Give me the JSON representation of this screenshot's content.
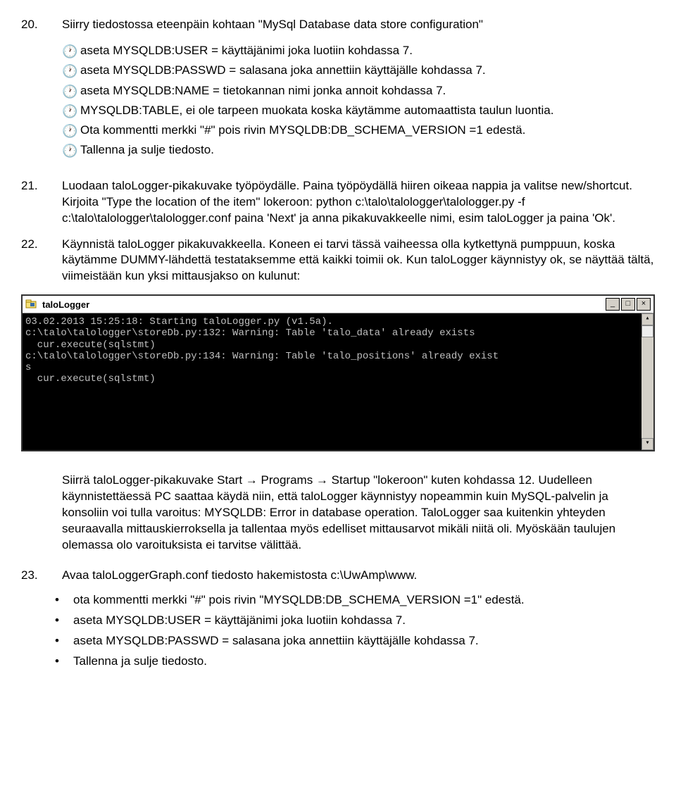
{
  "item20": {
    "num": "20.",
    "lead": "Siirry tiedostossa eteenpäin kohtaan \"MySql Database data store configuration\"",
    "bullets": [
      "aseta MYSQLDB:USER = käyttäjänimi joka luotiin kohdassa 7.",
      "aseta  MYSQLDB:PASSWD = salasana joka annettiin käyttäjälle kohdassa 7.",
      "aseta  MYSQLDB:NAME = tietokannan nimi jonka annoit kohdassa 7.",
      "MYSQLDB:TABLE, ei ole tarpeen muokata koska käytämme automaattista taulun luontia.",
      "Ota kommentti merkki \"#\" pois rivin  MYSQLDB:DB_SCHEMA_VERSION =1 edestä.",
      "Tallenna ja sulje tiedosto."
    ]
  },
  "item21": {
    "num": "21.",
    "text": "Luodaan taloLogger-pikakuvake työpöydälle. Paina työpöydällä hiiren oikeaa nappia ja valitse new/shortcut. Kirjoita \"Type the location of the item\" lokeroon: python c:\\talo\\talologger\\talologger.py -f  c:\\talo\\talologger\\talologger.conf paina 'Next' ja anna pikakuvakkeelle nimi, esim taloLogger ja paina 'Ok'."
  },
  "item22": {
    "num": "22.",
    "text": "Käynnistä taloLogger pikakuvakkeella. Koneen ei tarvi tässä vaiheessa olla kytkettynä pumppuun, koska käytämme DUMMY-lähdettä testataksemme että kaikki toimii ok. Kun taloLogger käynnistyy ok, se näyttää tältä, viimeistään kun yksi mittausjakso on kulunut:"
  },
  "terminal": {
    "title": "taloLogger",
    "lines": "03.02.2013 15:25:18: Starting taloLogger.py (v1.5a).\nc:\\talo\\talologger\\storeDb.py:132: Warning: Table 'talo_data' already exists\n  cur.execute(sqlstmt)\nc:\\talo\\talologger\\storeDb.py:134: Warning: Table 'talo_positions' already exist\ns\n  cur.execute(sqlstmt)"
  },
  "after22": "Siirrä taloLogger-pikakuvake Start → Programs → Startup \"lokeroon\" kuten kohdassa 12. Uudelleen käynnistettäessä PC saattaa käydä niin, että taloLogger käynnistyy nopeammin kuin MySQL-palvelin ja konsoliin voi tulla varoitus: MYSQLDB: Error in database operation. TaloLogger saa kuitenkin yhteyden seuraavalla mittauskierroksella ja tallentaa myös edelliset mittausarvot mikäli niitä oli. Myöskään taulujen olemassa olo varoituksista ei tarvitse välittää.",
  "item23": {
    "num": "23.",
    "text": "Avaa taloLoggerGraph.conf tiedosto hakemistosta c:\\UwAmp\\www.",
    "bullets": [
      "ota kommentti merkki \"#\" pois rivin \"MYSQLDB:DB_SCHEMA_VERSION =1\" edestä.",
      "aseta MYSQLDB:USER = käyttäjänimi joka luotiin kohdassa 7.",
      "aseta  MYSQLDB:PASSWD = salasana joka annettiin käyttäjälle kohdassa 7.",
      "Tallenna ja sulje tiedosto."
    ]
  },
  "glyph": {
    "clock": "🕐",
    "dot": "•",
    "min": "_",
    "max": "□",
    "close": "×",
    "up": "▴",
    "down": "▾"
  }
}
